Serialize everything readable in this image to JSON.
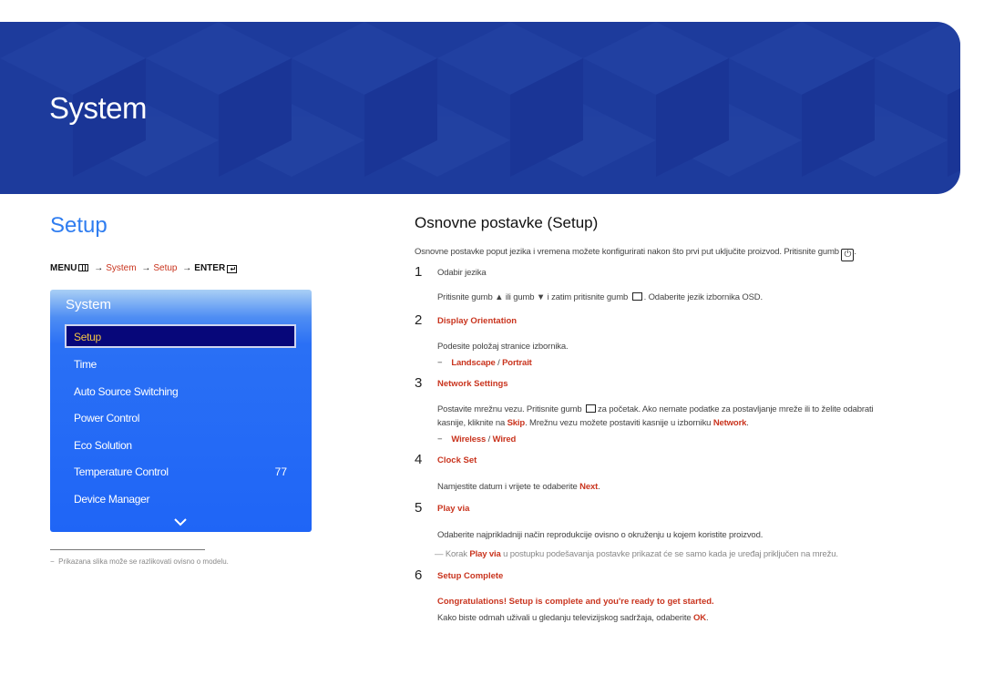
{
  "banner": {
    "title": "System"
  },
  "section": {
    "title": "Setup",
    "breadcrumb": {
      "menu": "MENU",
      "arrow": "→",
      "system": "System",
      "setup": "Setup",
      "enter": "ENTER"
    }
  },
  "osd_menu": {
    "title": "System",
    "items": [
      {
        "label": "Setup",
        "selected": true
      },
      {
        "label": "Time"
      },
      {
        "label": "Auto Source Switching"
      },
      {
        "label": "Power Control"
      },
      {
        "label": "Eco Solution"
      },
      {
        "label": "Temperature Control",
        "value": "77"
      },
      {
        "label": "Device Manager"
      }
    ],
    "more_icon": "chevron-down-icon"
  },
  "footnote": "Prikazana slika može se razlikovati ovisno o modelu.",
  "footnote_dash": "−",
  "content": {
    "heading": "Osnovne postavke (Setup)",
    "intro": "Osnovne postavke poput jezika i vremena možete konfigurirati nakon što prvi put uključite proizvod. Pritisnite gumb",
    "steps": [
      {
        "num": "1",
        "title": "Odabir jezika",
        "text_a": "Pritisnite gumb",
        "text_b": "ili gumb",
        "text_c": "i zatim pritisnite gumb",
        "text_d": ". Odaberite jezik izbornika OSD."
      },
      {
        "num": "2",
        "title": "Display Orientation",
        "text": "Podesite položaj stranice izbornika.",
        "opt_a": "Landscape",
        "opt_b": "Portrait"
      },
      {
        "num": "3",
        "title": "Network Settings",
        "line1_a": "Postavite mrežnu vezu. Pritisnite gumb",
        "line1_b": "za početak. Ako nemate podatke za postavljanje mreže ili to želite odabrati",
        "line2_a": "kasnije, kliknite na",
        "line2_skip": "Skip",
        "line2_b": ". Mrežnu vezu možete postaviti kasnije u izborniku",
        "line2_net": "Network",
        "opt_a": "Wireless",
        "opt_b": "Wired"
      },
      {
        "num": "4",
        "title": "Clock Set",
        "text_a": "Namjestite datum i vrijete te odaberite",
        "text_next": "Next"
      },
      {
        "num": "5",
        "title": "Play via",
        "text": "Odaberite najprikladniji način reprodukcije ovisno o okruženju u kojem koristite proizvod.",
        "note_a": "Korak",
        "note_b": "Play via",
        "note_c": "u postupku podešavanja postavke prikazat će se samo kada je uređaj priključen na mrežu."
      },
      {
        "num": "6",
        "title": "Setup Complete",
        "congrats": "Congratulations! Setup is complete and you're ready to get started.",
        "text_a": "Kako biste odmah uživali u gledanju televizijskog sadržaja, odaberite",
        "text_ok": "OK"
      }
    ]
  },
  "colors": {
    "banner": "#1d3b9c",
    "section_title": "#2f7df0",
    "accent_red": "#c9341e",
    "menu_panel": "#1f65f6",
    "menu_selected_bg": "#07077a",
    "menu_selected_text": "#f4c542"
  }
}
